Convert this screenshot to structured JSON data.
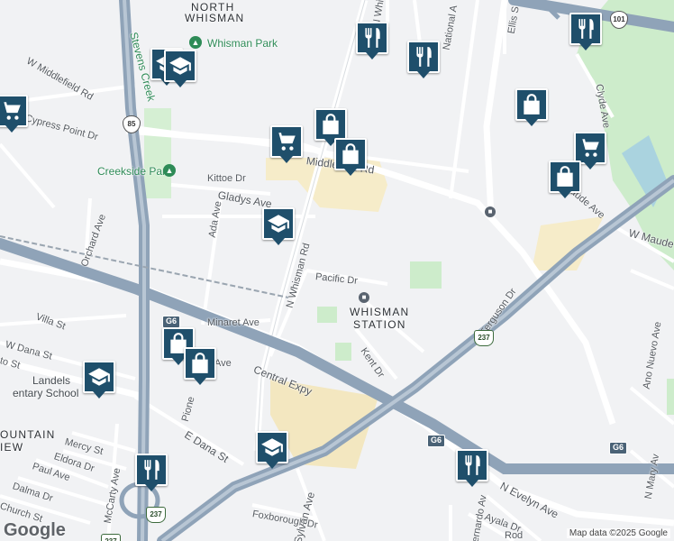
{
  "areas": {
    "north_whisman_1": "NORTH",
    "north_whisman_2": "WHISMAN",
    "whisman_station_1": "WHISMAN",
    "whisman_station_2": "STATION",
    "landels_1": "Landels",
    "landels_2": "entary School",
    "mountain_view_1": "OUNTAIN",
    "mountain_view_2": "IEW"
  },
  "parks": {
    "whisman_park": "Whisman Park",
    "creekside_park": "Creekside Park",
    "stevens_creek": "Stevens Creek"
  },
  "streets": {
    "n_whisman_rd_top": "N Whisman",
    "n_whisman_rd": "N Whisman Rd",
    "national_ave": "National A",
    "ellis": "Ellis S",
    "clyde_ave": "Clyde Ave",
    "w_middlefield_rd": "W Middlefield Rd",
    "middlefield_rd": "Middlefield Rd",
    "cypress_point_dr": "Cypress Point Dr",
    "kittoe_dr": "Kittoe Dr",
    "gladys_ave": "Gladys Ave",
    "ada_ave": "Ada Ave",
    "maude_ave": "aude Ave",
    "w_maude": "W Maude",
    "orchard_ave": "Orchard Ave",
    "pacific_dr": "Pacific Dr",
    "ferguson_dr": "Ferguson Dr",
    "minaret_ave": "Minaret Ave",
    "villa_st": "Villa St",
    "w_dana_st": "W Dana St",
    "to_st": "to St",
    "kent_dr": "Kent Dr",
    "central_expy": "Central Expy",
    "ave_frag": "Ave",
    "pioneer_way": "Pione",
    "e_dana_st": "E Dana St",
    "mercy_st": "Mercy St",
    "eldora_dr": "Eldora Dr",
    "paul_ave": "Paul Ave",
    "dalma_dr": "Dalma Dr",
    "church_st": "Church St",
    "mccarty_ave": "McCarty Ave",
    "foxborough_dr": "Foxborough Dr",
    "sylvan_ave": "Sylvan Ave",
    "bernardo_ave": "ernardo Av",
    "n_evelyn_ave": "N Evelyn Ave",
    "ayala_dr": "Ayala Dr",
    "ano_nuevo_ave": "Ano Nuevo Ave",
    "n_mary_av": "N Mary Av",
    "rod": "Rod",
    "ave_right": "Ave"
  },
  "shields": {
    "us101": "101",
    "ca85_a": "85",
    "ca85_b": "85",
    "g6_a": "G6",
    "g6_b": "G6",
    "g6_c": "G6",
    "ca237_a": "237",
    "ca237_b": "237",
    "ca237_c": "237"
  },
  "markers": [
    {
      "icon": "restaurant-icon"
    },
    {
      "icon": "restaurant-icon"
    },
    {
      "icon": "restaurant-icon"
    },
    {
      "icon": "restaurant-icon"
    },
    {
      "icon": "restaurant-icon"
    },
    {
      "icon": "school-icon"
    },
    {
      "icon": "school-icon"
    },
    {
      "icon": "school-icon"
    },
    {
      "icon": "school-icon"
    },
    {
      "icon": "school-icon"
    },
    {
      "icon": "shopping-cart-icon"
    },
    {
      "icon": "shopping-cart-icon"
    },
    {
      "icon": "shopping-cart-icon"
    },
    {
      "icon": "shopping-bag-icon"
    },
    {
      "icon": "shopping-bag-icon"
    },
    {
      "icon": "shopping-bag-icon"
    },
    {
      "icon": "shopping-bag-icon"
    },
    {
      "icon": "shopping-bag-icon"
    },
    {
      "icon": "shopping-bag-icon"
    }
  ],
  "logo": "Google",
  "attribution": "Map data ©2025 Google",
  "colors": {
    "marker": "#1f4f6b",
    "park": "#cdeccb",
    "highway": "#8fa3b8",
    "background": "#f1f2f4"
  }
}
